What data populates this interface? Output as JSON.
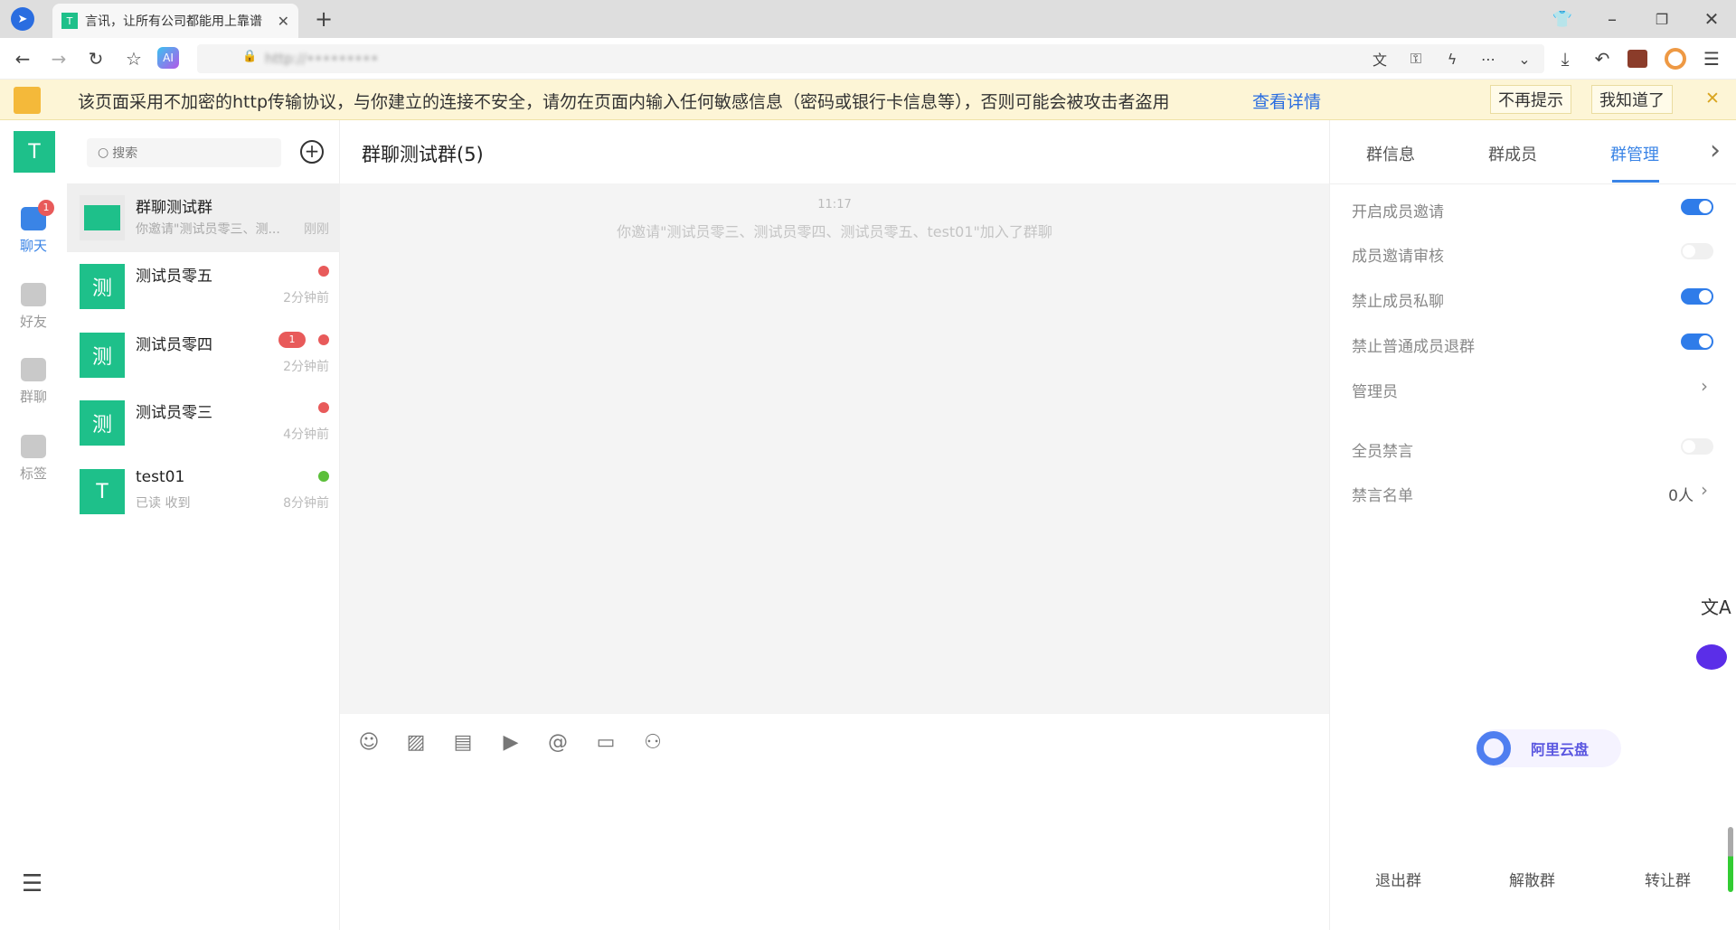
{
  "browser": {
    "tab_title": "言讯，让所有公司都能用上靠谱",
    "tab_favicon": "T",
    "url": "http://•••••••••"
  },
  "warning": {
    "text": "该页面采用不加密的http传输协议，与你建立的连接不安全，请勿在页面内输入任何敏感信息（密码或银行卡信息等），否则可能会被攻击者盗用",
    "link": "查看详情",
    "dont_remind": "不再提示",
    "got_it": "我知道了"
  },
  "nav": {
    "avatar": "T",
    "items": [
      {
        "label": "聊天",
        "badge": "1"
      },
      {
        "label": "好友"
      },
      {
        "label": "群聊"
      },
      {
        "label": "标签"
      }
    ]
  },
  "list": {
    "search_placeholder": "搜索",
    "items": [
      {
        "name": "群聊测试群",
        "preview": "你邀请\"测试员零三、测...",
        "time": "刚刚"
      },
      {
        "name": "测试员零五",
        "avatar": "测",
        "preview": "",
        "time": "2分钟前",
        "dot": "#e85a5a"
      },
      {
        "name": "测试员零四",
        "avatar": "测",
        "preview": "",
        "time": "2分钟前",
        "dot": "#e85a5a",
        "badge": "1"
      },
      {
        "name": "测试员零三",
        "avatar": "测",
        "preview": "",
        "time": "4分钟前",
        "dot": "#e85a5a"
      },
      {
        "name": "test01",
        "avatar": "T",
        "preview": "已读 收到",
        "time": "8分钟前",
        "dot": "#5cbf3a"
      }
    ]
  },
  "chat": {
    "title": "群聊测试群(5)",
    "timestamp": "11:17",
    "system_message": "你邀请\"测试员零三、测试员零四、测试员零五、test01\"加入了群聊"
  },
  "panel": {
    "tabs": [
      "群信息",
      "群成员",
      "群管理"
    ],
    "active_tab": "群管理",
    "settings": [
      {
        "label": "开启成员邀请",
        "on": true
      },
      {
        "label": "成员邀请审核",
        "on": false
      },
      {
        "label": "禁止成员私聊",
        "on": true
      },
      {
        "label": "禁止普通成员退群",
        "on": true
      },
      {
        "label": "管理员"
      },
      {
        "label": "全员禁言",
        "on": false
      },
      {
        "label": "禁言名单",
        "value": "0人"
      }
    ],
    "actions": [
      "退出群",
      "解散群",
      "转让群"
    ],
    "aliyun": "阿里云盘"
  }
}
